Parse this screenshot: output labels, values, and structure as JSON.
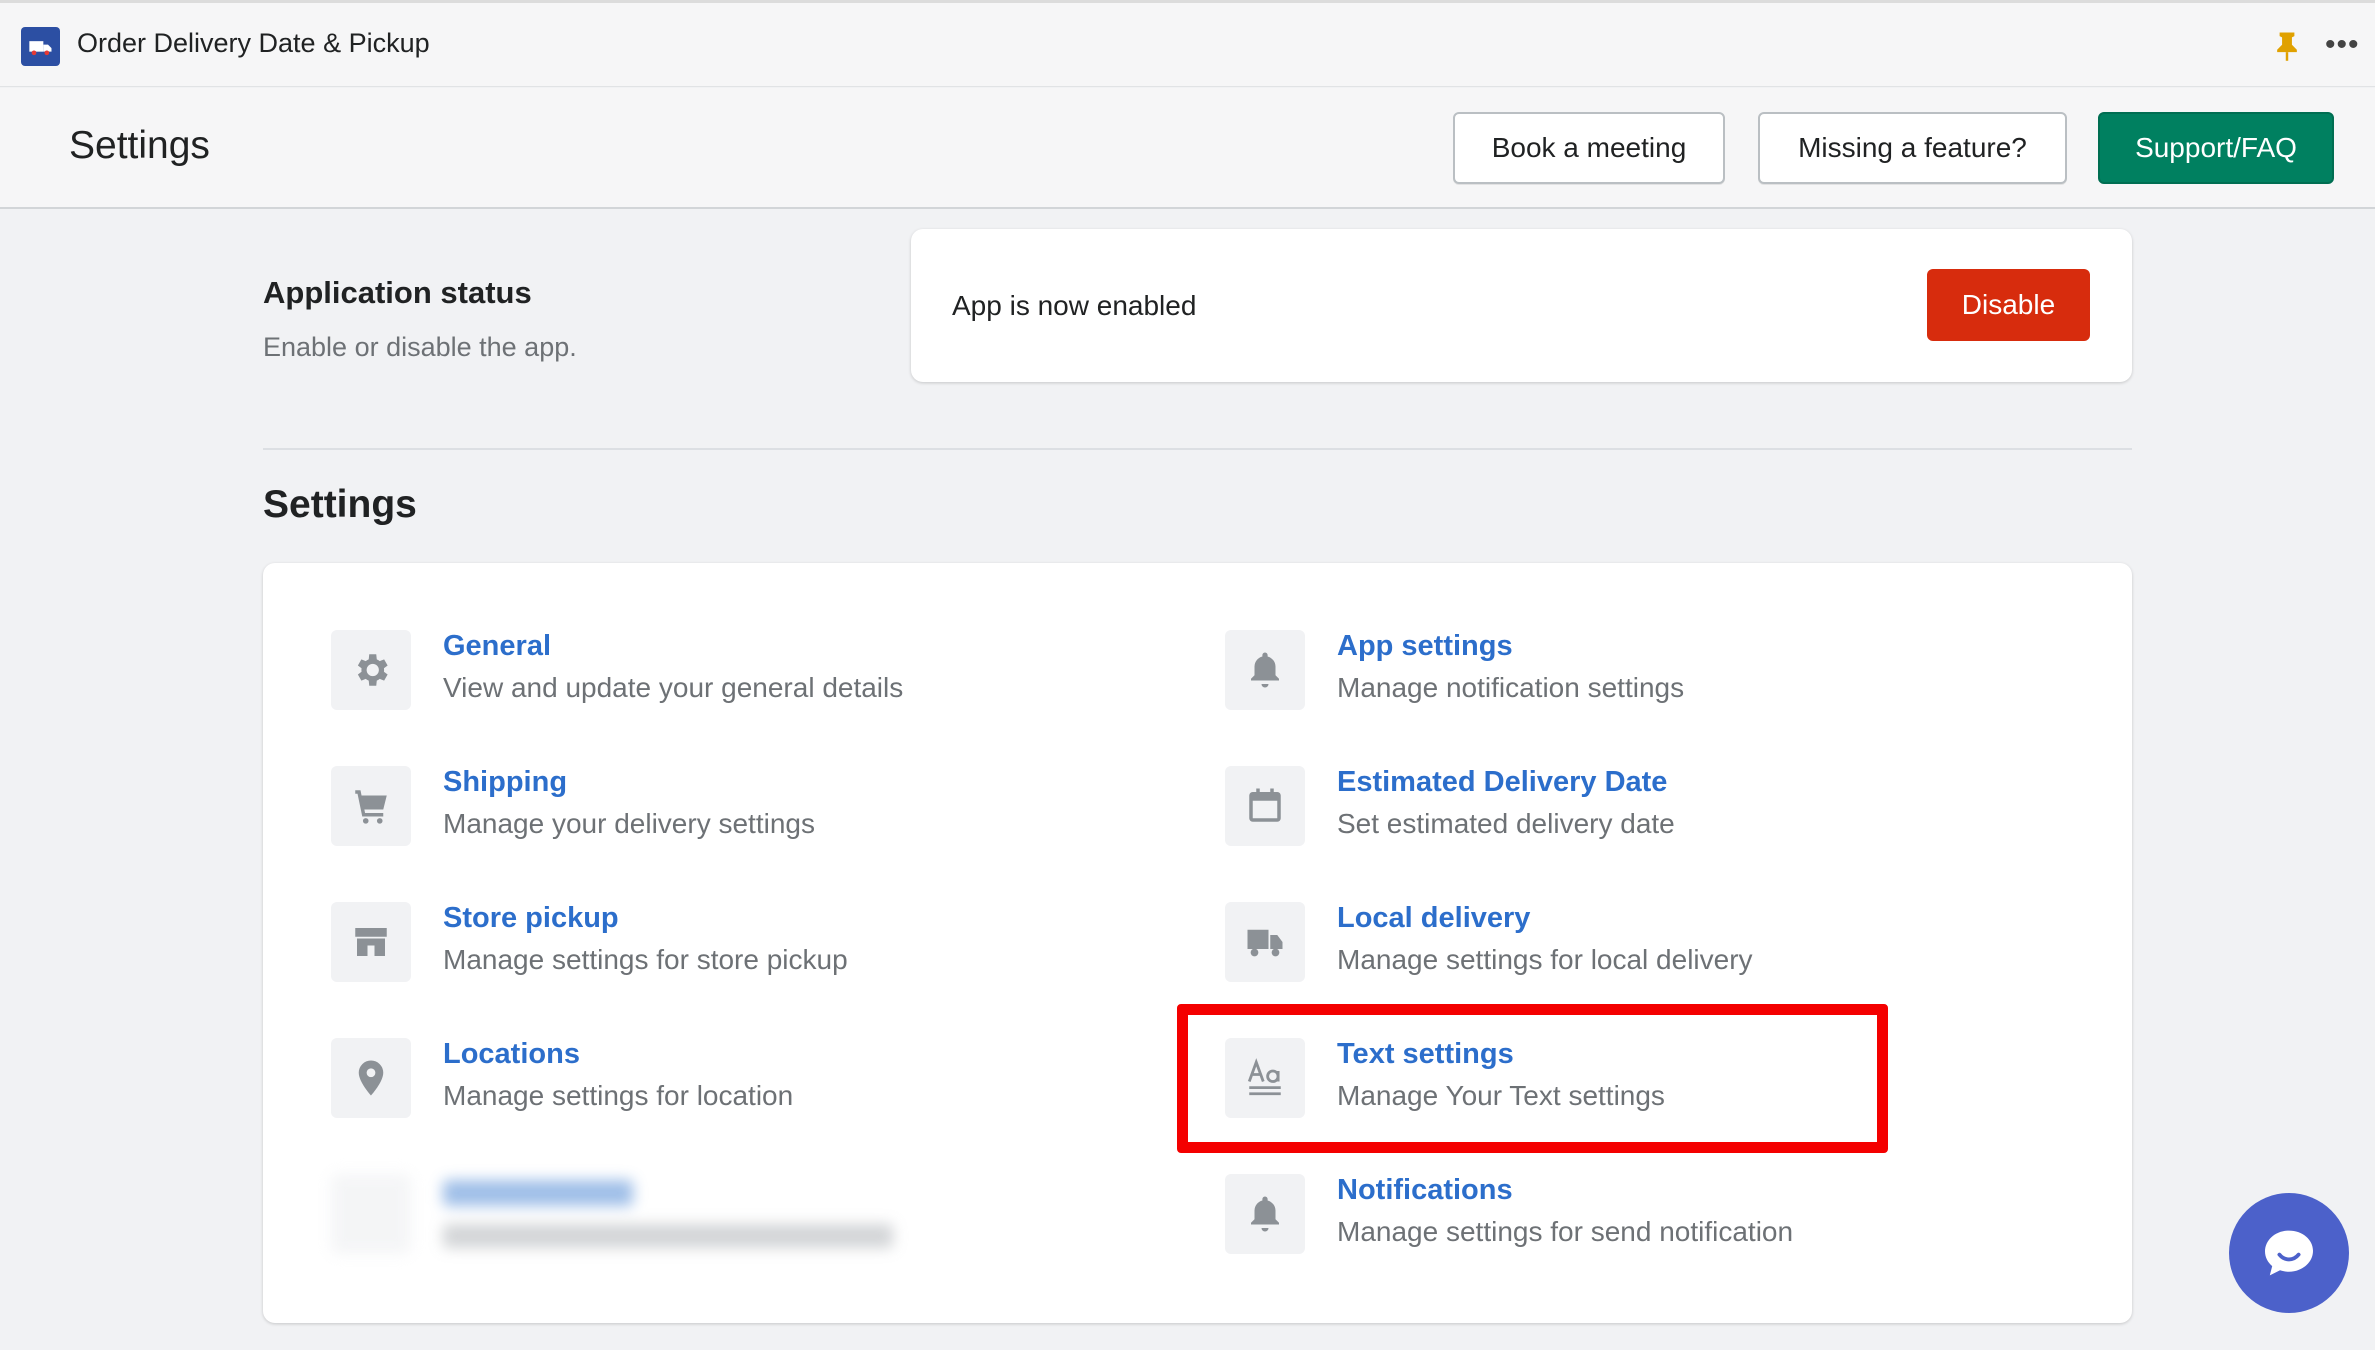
{
  "app": {
    "title": "Order Delivery Date & Pickup",
    "logo_icon": "delivery-truck-icon",
    "pin_icon": "pin-icon",
    "more_icon": "more-horizontal-icon",
    "more_label": "•••"
  },
  "header": {
    "title": "Settings",
    "buttons": {
      "book_meeting": "Book a meeting",
      "missing_feature": "Missing a feature?",
      "support": "Support/FAQ"
    }
  },
  "app_status": {
    "heading": "Application status",
    "description": "Enable or disable the app.",
    "status_text": "App is now enabled",
    "disable_label": "Disable"
  },
  "settings": {
    "heading": "Settings",
    "left": [
      {
        "icon": "gear-icon",
        "title": "General",
        "desc": "View and update your general details"
      },
      {
        "icon": "cart-icon",
        "title": "Shipping",
        "desc": "Manage your delivery settings"
      },
      {
        "icon": "store-icon",
        "title": "Store pickup",
        "desc": "Manage settings for store pickup"
      },
      {
        "icon": "location-pin-icon",
        "title": "Locations",
        "desc": "Manage settings for location"
      }
    ],
    "right": [
      {
        "icon": "bell-icon",
        "title": "App settings",
        "desc": "Manage notification settings"
      },
      {
        "icon": "calendar-icon",
        "title": "Estimated Delivery Date",
        "desc": "Set estimated delivery date"
      },
      {
        "icon": "truck-icon",
        "title": "Local delivery",
        "desc": "Manage settings for local delivery"
      },
      {
        "icon": "text-format-icon",
        "title": "Text settings",
        "desc": "Manage Your Text settings"
      },
      {
        "icon": "bell-icon",
        "title": "Notifications",
        "desc": "Manage settings for send notification"
      }
    ]
  },
  "colors": {
    "link": "#2c6ecb",
    "primary": "#008060",
    "critical": "#d72c0d",
    "highlight": "#f40000",
    "chat": "#4c61ca"
  },
  "chat": {
    "icon": "chat-bubble-icon"
  }
}
